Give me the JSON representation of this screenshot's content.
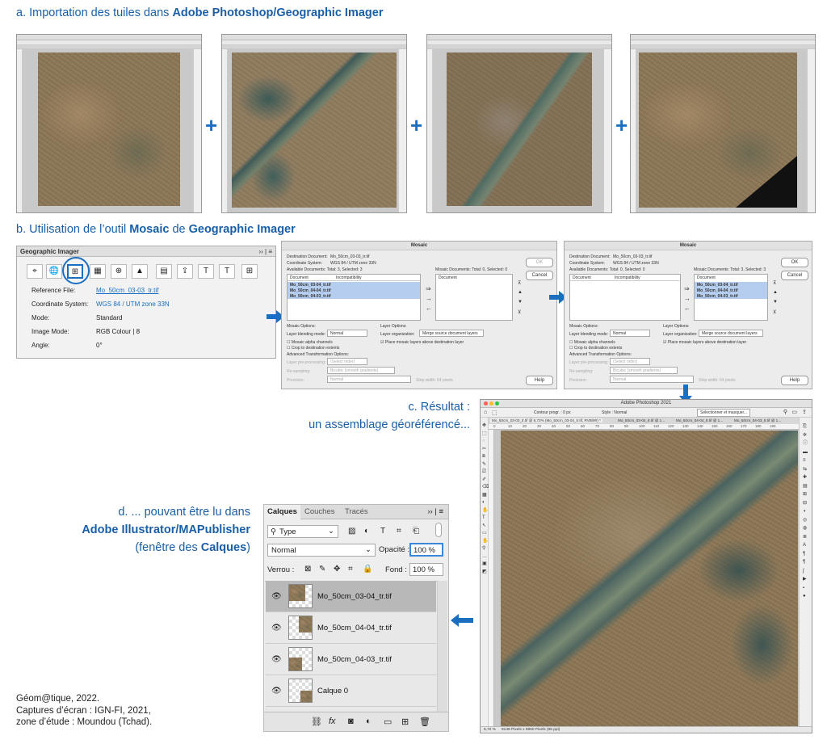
{
  "section_a": {
    "prefix": "a. Importation des tuiles dans ",
    "bold": "Adobe Photoshop/Geographic Imager",
    "plus": "+"
  },
  "section_b": {
    "prefix": "b. Utilisation de l’outil ",
    "bold1": "Mosaic",
    "middle": " de ",
    "bold2": "Geographic Imager"
  },
  "section_c": {
    "line1": "c. Résultat :",
    "line2": "un assemblage géoréférencé..."
  },
  "section_d": {
    "line1": "d. ... pouvant être lu dans",
    "line2": "Adobe Illustrator/MAPublisher",
    "line3_prefix": "(fenêtre des ",
    "line3_bold": "Calques",
    "line3_suffix": ")"
  },
  "geographic_imager": {
    "title": "Geographic Imager",
    "menu": "›› | ≡",
    "rows": [
      {
        "label": "Reference File:",
        "value": "Mo_50cm_03-03_tr.tif",
        "link": true
      },
      {
        "label": "Coordinate System:",
        "value": "WGS 84 / UTM zone 33N",
        "link": true
      },
      {
        "label": "Mode:",
        "value": "Standard",
        "link": false
      },
      {
        "label": "Image Mode:",
        "value": "RGB Colour | 8",
        "link": false
      },
      {
        "label": "Angle:",
        "value": "0°",
        "link": false
      }
    ],
    "accent": "#1a6fc1"
  },
  "mosaic_dialog_1": {
    "title": "Mosaic",
    "dest_label": "Destination Document:",
    "dest_value": "Mo_50cm_03-03_tr.tif",
    "cs_label": "Coordinate System:",
    "cs_value": "WGS 84 / UTM zone 33N",
    "available": "Available Documents: Total: 3, Selected: 3",
    "mosaic_docs": "Mosaic Documents: Total: 0, Selected: 0",
    "col_document": "Document",
    "col_incompat": "Incompatibility",
    "docs": [
      "Mo_50cm_03-04_tr.tif",
      "Mo_50cm_04-04_tr.tif",
      "Mo_50cm_04-03_tr.tif"
    ],
    "ok": "OK",
    "cancel": "Cancel",
    "help": "Help",
    "mosaic_options": "Mosaic Options:",
    "layer_options": "Layer Options:",
    "blending_label": "Layer blending mode:",
    "blending_value": "Normal",
    "organization_label": "Layer organization:",
    "organization_value": "Merge source document layers",
    "alpha": "Mosaic alpha channels",
    "crop": "Crop to destination extents",
    "place": "Place mosaic layers above destination layer",
    "advanced": "Advanced Transformation Options:",
    "preprocess_label": "Layer pre-processing:",
    "preprocess_value": "(Select order)",
    "resampling_label": "Re-sampling:",
    "resampling_value": "Bicubic (smooth gradients)",
    "precision_label": "Precision:",
    "precision_value": "Normal",
    "strip_label": "Strip width:",
    "strip_value": "64 pixels"
  },
  "mosaic_dialog_2": {
    "title": "Mosaic",
    "dest_label": "Destination Document:",
    "dest_value": "Mo_50cm_03-03_tr.tif",
    "cs_label": "Coordinate System:",
    "cs_value": "WGS 84 / UTM zone 33N",
    "available": "Available Documents: Total: 0, Selected: 0",
    "mosaic_docs": "Mosaic Documents: Total: 3, Selected: 3",
    "col_document": "Document",
    "col_incompat": "Incompatibility",
    "docs": [
      "Mo_50cm_03-04_tr.tif",
      "Mo_50cm_04-04_tr.tif",
      "Mo_50cm_04-03_tr.tif"
    ],
    "ok": "OK",
    "cancel": "Cancel",
    "help": "Help"
  },
  "photoshop_result": {
    "title": "Adobe Photoshop 2021",
    "contour": "Contour progr. : 0 px",
    "style": "Style : Normal",
    "select_btn": "Sélectionner et masquer...",
    "tab1": "Mo_50cm_03-03_tr.tif @ 6,72% (Mo_50cm_03-04_tr.tif, RVB/8#) *",
    "tab2": "Mo_50cm_03-04_tr.tif @ 1...",
    "tab3": "Mo_50cm_04-04_tr.tif @ 1...",
    "tab4": "Mo_50cm_04-03_tr.tif @ 1...",
    "ruler": [
      "0",
      "10",
      "20",
      "30",
      "40",
      "50",
      "60",
      "70",
      "80",
      "90",
      "100",
      "110",
      "120",
      "130",
      "140",
      "150",
      "160",
      "170",
      "180",
      "190"
    ],
    "status_zoom": "6,72 %",
    "status_info": "9149 Pixels x 9960 Pixels (96 ppi)"
  },
  "layers_panel": {
    "tabs": [
      "Calques",
      "Couches",
      "Tracés"
    ],
    "menu": "›› | ≡",
    "filter_value": "Type",
    "blend_value": "Normal",
    "opacity_label": "Opacité :",
    "opacity_value": "100 %",
    "lock_label": "Verrou :",
    "fill_label": "Fond :",
    "fill_value": "100 %",
    "layers": [
      {
        "name": "Mo_50cm_03-04_tr.tif",
        "selected": true
      },
      {
        "name": "Mo_50cm_04-04_tr.tif",
        "selected": false
      },
      {
        "name": "Mo_50cm_04-03_tr.tif",
        "selected": false
      },
      {
        "name": "Calque 0",
        "selected": false
      }
    ],
    "selected_color": "#b8b8b8"
  },
  "credits": {
    "line1": "Géom@tique, 2022.",
    "line2": "Captures d’écran : IGN-FI, 2021,",
    "line3": "zone d’étude : Moundou (Tchad)."
  }
}
